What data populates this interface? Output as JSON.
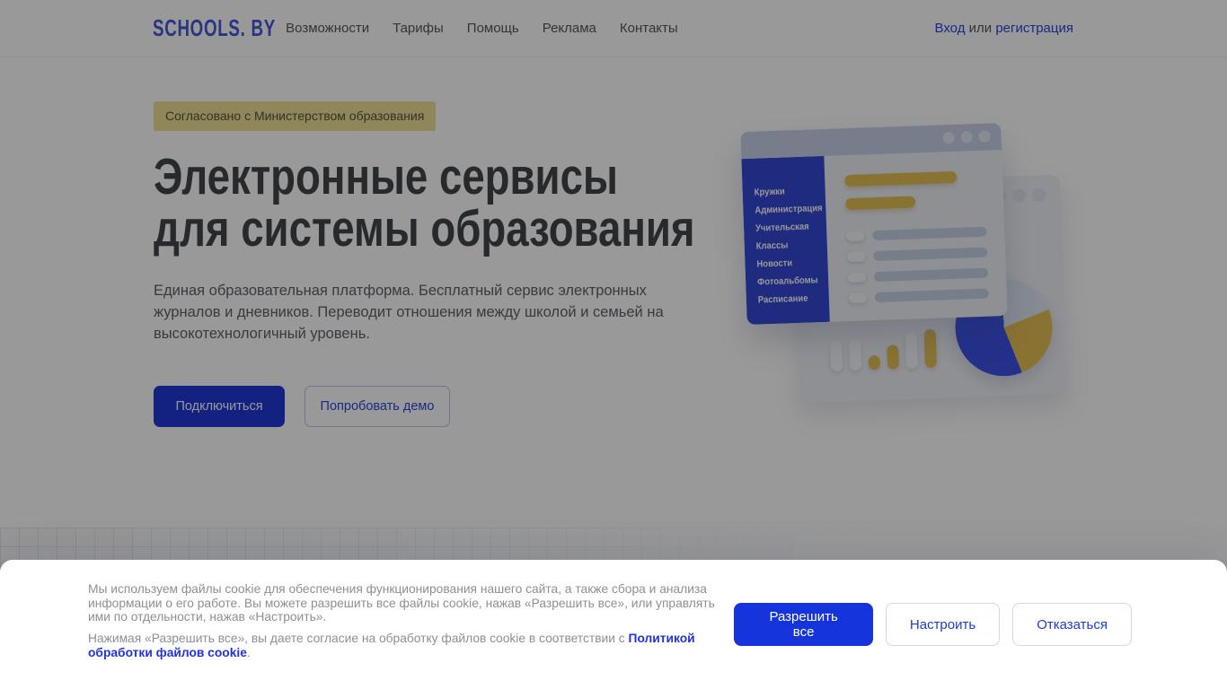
{
  "brand": {
    "logo_text": "SCHOOLS. BY"
  },
  "header": {
    "nav": [
      "Возможности",
      "Тарифы",
      "Помощь",
      "Реклама",
      "Контакты"
    ],
    "auth": {
      "login": "Вход",
      "separator": " или ",
      "register": "регистрация"
    }
  },
  "hero": {
    "badge": "Согласовано с Министерством образования",
    "title_line1": "Электронные сервисы",
    "title_line2": "для системы образования",
    "description": "Единая образовательная платформа. Бесплатный сервис электронных журналов и дневников. Переводит отношения между школой и семьей на высокотехнологичный уровень.",
    "primary_button": "Подключиться",
    "secondary_button": "Попробовать демо"
  },
  "illustration": {
    "window_menu": [
      "Кружки",
      "Администрация",
      "Учительская",
      "Классы",
      "Новости",
      "Фотоальбомы",
      "Расписание"
    ]
  },
  "cookie_banner": {
    "paragraph1": "Мы используем файлы cookie для обеспечения функционирования нашего сайта, а также сбора и анализа информации о его работе. Вы можете разрешить все файлы cookie, нажав «Разрешить все», или управлять ими по отдельности, нажав «Настроить».",
    "paragraph2_prefix": "Нажимая «Разрешить все», вы даете согласие на обработку файлов cookie в соответствии с ",
    "paragraph2_link": "Политикой обработки файлов cookie",
    "paragraph2_suffix": ".",
    "allow_button": "Разрешить все",
    "configure_button": "Настроить",
    "decline_button": "Отказаться"
  },
  "colors": {
    "primary_blue": "#1d36da",
    "badge_yellow": "#eedf97",
    "accent_yellow": "#e5c055",
    "sidebar_blue": "#3349d2",
    "dim_overlay": "rgba(0,0,0,0.4)"
  }
}
